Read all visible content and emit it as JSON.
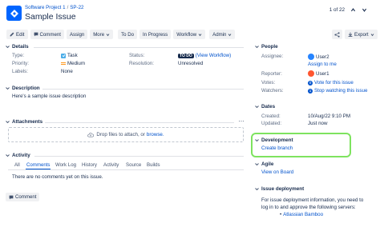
{
  "header": {
    "project": "Software Project 1",
    "separator": "/",
    "issue_key": "SP-22",
    "title": "Sample Issue",
    "pager": "1 of 22"
  },
  "toolbar": {
    "edit": "Edit",
    "comment": "Comment",
    "assign": "Assign",
    "more": "More",
    "todo": "To Do",
    "in_progress": "In Progress",
    "workflow": "Workflow",
    "admin": "Admin",
    "export": "Export"
  },
  "details": {
    "heading": "Details",
    "type_label": "Type:",
    "type_value": "Task",
    "priority_label": "Priority:",
    "priority_value": "Medium",
    "labels_label": "Labels:",
    "labels_value": "None",
    "status_label": "Status:",
    "status_badge": "TO DO",
    "status_link": "(View Workflow)",
    "resolution_label": "Resolution:",
    "resolution_value": "Unresolved"
  },
  "description": {
    "heading": "Description",
    "text": "Here's a sample issue description"
  },
  "attachments": {
    "heading": "Attachments",
    "drop_text": "Drop files to attach, or ",
    "browse": "browse."
  },
  "activity": {
    "heading": "Activity",
    "tabs": [
      "All",
      "Comments",
      "Work Log",
      "History",
      "Activity",
      "Source",
      "Builds"
    ],
    "empty": "There are no comments yet on this issue.",
    "comment_button": "Comment"
  },
  "people": {
    "heading": "People",
    "assignee_label": "Assignee:",
    "assignee": "User2",
    "assign_to_me": "Assign to me",
    "reporter_label": "Reporter:",
    "reporter": "User1",
    "votes_label": "Votes:",
    "votes_count": "0",
    "vote_link": "Vote for this issue",
    "watchers_label": "Watchers:",
    "watchers_count": "1",
    "watch_link": "Stop watching this issue"
  },
  "dates": {
    "heading": "Dates",
    "created_label": "Created:",
    "created": "10/Aug/22 9:10 PM",
    "updated_label": "Updated:",
    "updated": "Just now"
  },
  "development": {
    "heading": "Development",
    "create_branch": "Create branch",
    "highlight_color": "#7ee35f"
  },
  "agile": {
    "heading": "Agile",
    "view_on_board": "View on Board"
  },
  "deployment": {
    "heading": "Issue deployment",
    "text_line1": "For issue deployment information, you need to",
    "text_line2": "log in to and approve the following servers:",
    "server": "Atlassian Bamboo"
  },
  "colors": {
    "link": "#0052cc",
    "task_icon": "#4bade8",
    "priority": "#ff991f"
  }
}
